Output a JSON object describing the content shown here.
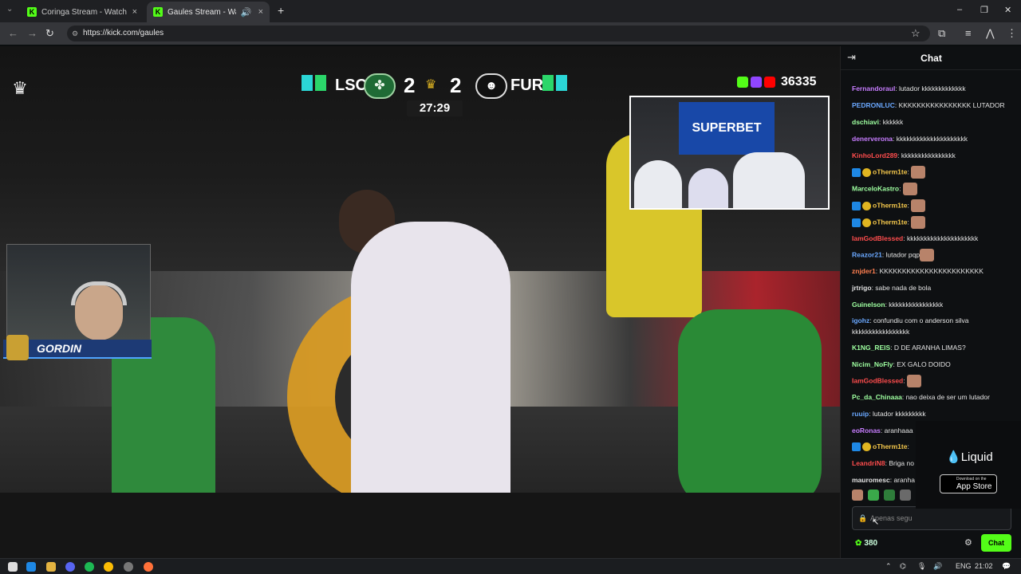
{
  "browser": {
    "tabs": [
      {
        "label": "Coringa Stream - Watch Live on",
        "active": false
      },
      {
        "label": "Gaules Stream - Watch Live",
        "active": true
      }
    ],
    "url": "https://kick.com/gaules"
  },
  "stream": {
    "team_left": "LSC",
    "team_right": "FUR",
    "score_left": "2",
    "score_right": "2",
    "clock": "27:29",
    "viewer_count": "36335",
    "inset_banner": "SUPERBET",
    "streamer_name": "GORDIN"
  },
  "chat": {
    "title": "Chat",
    "messages": [
      {
        "user": "Fernandoraul",
        "color": "#c77dff",
        "text": "lutador kkkkkkkkkkkkk"
      },
      {
        "user": "PEDRONLUC",
        "color": "#6aa8ff",
        "text": "KKKKKKKKKKKKKKKK LUTADOR"
      },
      {
        "user": "dschiavi",
        "color": "#9effa0",
        "text": "kkkkkk"
      },
      {
        "user": "denerverona",
        "color": "#c77dff",
        "text": "kkkkkkkkkkkkkkkkkkkkk"
      },
      {
        "user": "KinhoLord289",
        "color": "#ff4d4d",
        "text": "kkkkkkkkkkkkkkkk"
      },
      {
        "user": "oTherm1te",
        "color": "#f5c84c",
        "text": "",
        "badges": true,
        "emote": true
      },
      {
        "user": "MarceloKastro",
        "color": "#9effa0",
        "text": "",
        "emote": true
      },
      {
        "user": "oTherm1te",
        "color": "#f5c84c",
        "text": "",
        "badges": true,
        "emote": true
      },
      {
        "user": "oTherm1te",
        "color": "#f5c84c",
        "text": "",
        "badges": true,
        "emote": true
      },
      {
        "user": "IamGodBlessed",
        "color": "#ff4d4d",
        "text": "kkkkkkkkkkkkkkkkkkkkk"
      },
      {
        "user": "Reazor21",
        "color": "#6aa8ff",
        "text": "lutador pqp",
        "emote": true
      },
      {
        "user": "znjder1",
        "color": "#ff7f50",
        "text": "KKKKKKKKKKKKKKKKKKKKKKK"
      },
      {
        "user": "jrtrigo",
        "color": "#e3e3e3",
        "text": "sabe nada de bola"
      },
      {
        "user": "Guinelson",
        "color": "#9effa0",
        "text": "kkkkkkkkkkkkkkkk"
      },
      {
        "user": "igohz",
        "color": "#6aa8ff",
        "text": "confundiu com o anderson silva kkkkkkkkkkkkkkkkk"
      },
      {
        "user": "K1NG_REIS",
        "color": "#9effa0",
        "text": "D DE ARANHA LIMAS?"
      },
      {
        "user": "Nicim_NoFly",
        "color": "#9effa0",
        "text": "EX GALO DOIDO"
      },
      {
        "user": "IamGodBlessed",
        "color": "#ff4d4d",
        "text": "",
        "emote": true
      },
      {
        "user": "Pc_da_Chinaaa",
        "color": "#9effa0",
        "text": "nao deixa de ser um lutador"
      },
      {
        "user": "ruuip",
        "color": "#6aa8ff",
        "text": "lutador kkkkkkkkk"
      },
      {
        "user": "eoRonas",
        "color": "#c77dff",
        "text": "aranhaaa"
      },
      {
        "user": "oTherm1te",
        "color": "#f5c84c",
        "text": "",
        "badges": true
      },
      {
        "user": "LeandriN8",
        "color": "#ff4d4d",
        "text": "Briga no"
      },
      {
        "user": "mauromesc",
        "color": "#e3e3e3",
        "text": "aranha"
      }
    ],
    "input_placeholder": "Apenas segu",
    "points": "380",
    "send_label": "Chat"
  },
  "ad": {
    "brand": "Liquid",
    "store_small": "Download on the",
    "store_big": "App Store"
  },
  "taskbar": {
    "lang": "ENG",
    "time": "21:02"
  },
  "colors": {
    "accent": "#53fc18",
    "chat_bg": "#0e1012"
  }
}
